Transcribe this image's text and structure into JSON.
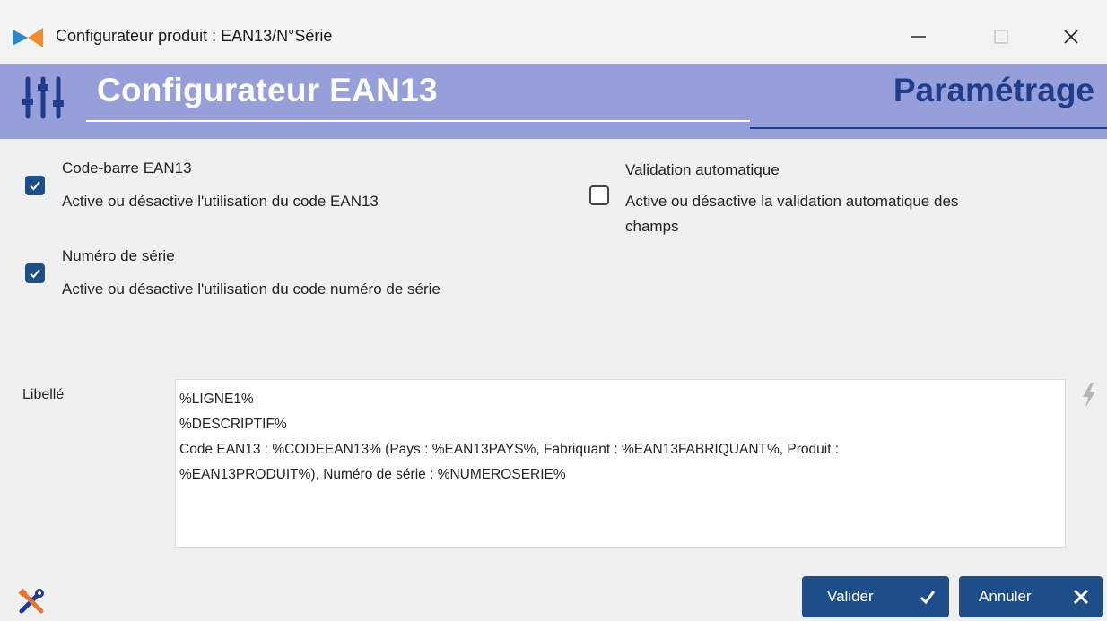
{
  "window": {
    "title": "Configurateur produit : EAN13/N°Série",
    "min_label": "—",
    "max_label": "☐",
    "close_label": "✕"
  },
  "banner": {
    "title": "Configurateur EAN13",
    "section": "Paramétrage"
  },
  "options": [
    {
      "title": "Code-barre EAN13",
      "description": "Active ou désactive l'utilisation du code EAN13",
      "checked": true
    },
    {
      "title": "Numéro de série",
      "description": "Active ou désactive l'utilisation du code numéro de série",
      "checked": true
    },
    {
      "title": "Validation automatique",
      "description_line1": "Active ou désactive la validation automatique des",
      "description_line2": "champs",
      "checked": false
    }
  ],
  "libelle": {
    "label": "Libellé",
    "lines": [
      "%LIGNE1%",
      "%DESCRIPTIF%",
      "Code EAN13 : %CODEEAN13% (Pays : %EAN13PAYS%, Fabriquant : %EAN13FABRIQUANT%, Produit :",
      "%EAN13PRODUIT%), Numéro de série : %NUMEROSERIE%"
    ]
  },
  "buttons": {
    "validate": "Valider",
    "cancel": "Annuler"
  },
  "colors": {
    "accent": "#1d4e89",
    "banner": "#979fdb",
    "section_title": "#1f3d8a"
  },
  "icons": [
    "app-icon",
    "sliders-icon",
    "check-icon",
    "close-icon",
    "lightning-icon",
    "tools-icon"
  ]
}
